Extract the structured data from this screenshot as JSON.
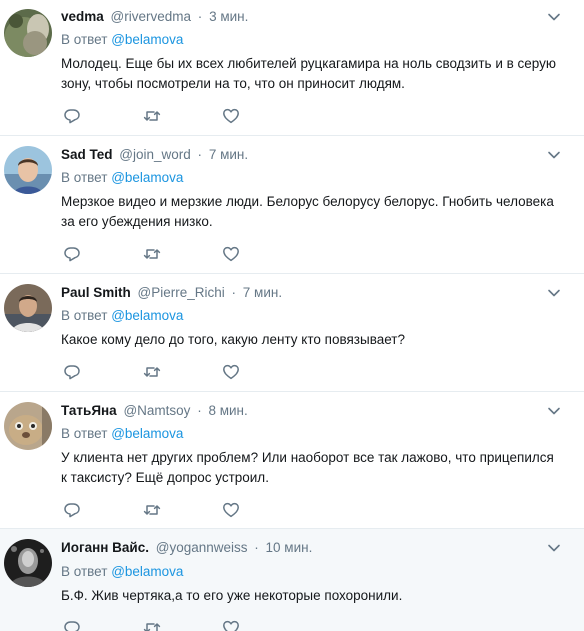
{
  "colors": {
    "text": "#14171a",
    "secondary": "#657786",
    "mention": "#1b95e0",
    "divider": "#e6ecf0",
    "highlight_bg": "#f5f8fa"
  },
  "icons": {
    "reply": "reply-icon",
    "retweet": "retweet-icon",
    "like": "heart-icon",
    "more": "chevron-down-icon"
  },
  "tweets": [
    {
      "fullname": "vedma",
      "handle": "@rivervedma",
      "separator": "·",
      "time": "3 мин.",
      "reply_prefix": "В ответ",
      "reply_to": "@belamova",
      "text": "Молодец. Еще бы их всех любителей руцкагамира на ноль сводзить и в серую зону, чтобы посмотрели на то, что он приносит людям."
    },
    {
      "fullname": "Sad Ted",
      "handle": "@join_word",
      "separator": "·",
      "time": "7 мин.",
      "reply_prefix": "В ответ",
      "reply_to": "@belamova",
      "text": "Мерзкое видео и мерзкие люди. Белорус белорусу белорус. Гнобить человека за его убеждения низко."
    },
    {
      "fullname": "Paul Smith",
      "handle": "@Pierre_Richi",
      "separator": "·",
      "time": "7 мин.",
      "reply_prefix": "В ответ",
      "reply_to": "@belamova",
      "text": "Какое кому дело до того, какую ленту кто повязывает?"
    },
    {
      "fullname": "ТатьЯна",
      "handle": "@Namtsoy",
      "separator": "·",
      "time": "8 мин.",
      "reply_prefix": "В ответ",
      "reply_to": "@belamova",
      "text": "У клиента нет других проблем? Или наоборот все так лажово, что прицепился к таксисту? Ещё допрос устроил."
    },
    {
      "fullname": "Иоганн Вайс.",
      "handle": "@yogannweiss",
      "separator": "·",
      "time": "10 мин.",
      "reply_prefix": "В ответ",
      "reply_to": "@belamova",
      "text": "Б.Ф. Жив чертяка,а то его уже некоторые похоронили."
    }
  ]
}
